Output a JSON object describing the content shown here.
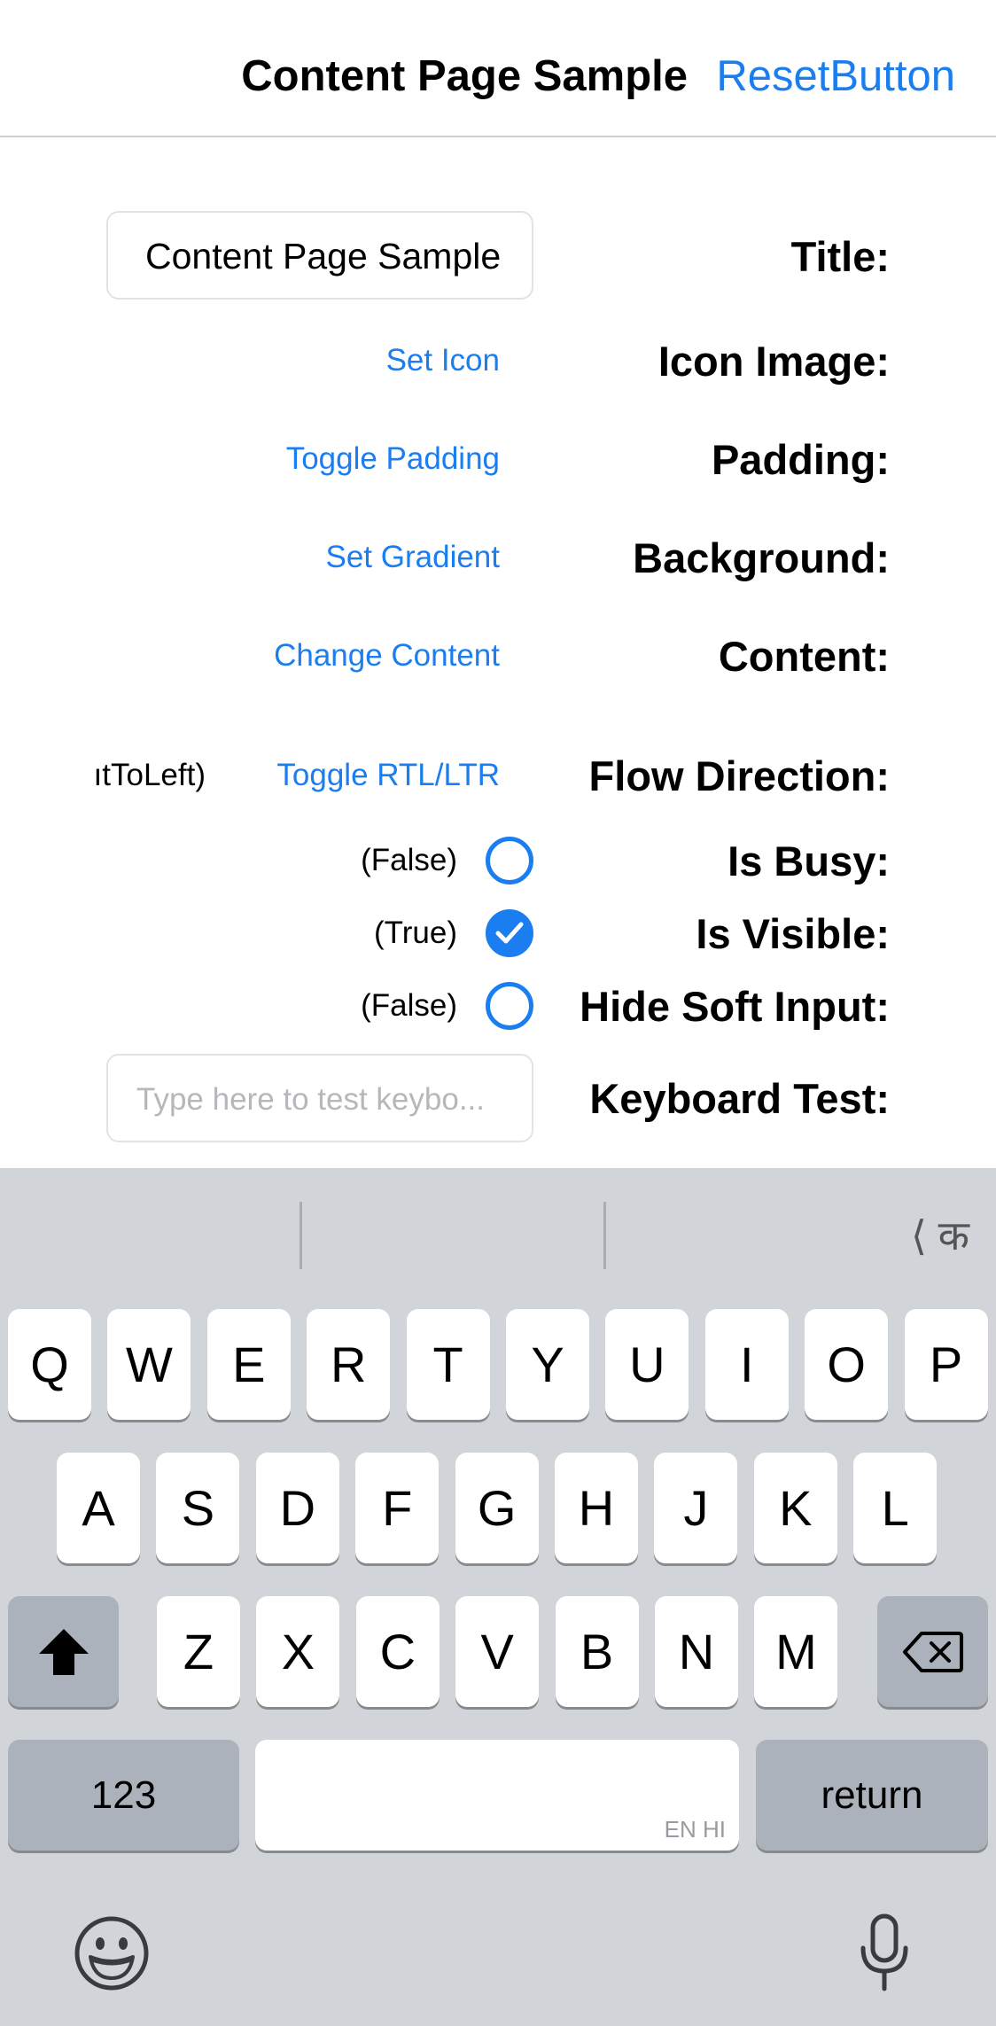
{
  "nav": {
    "title": "Content Page Sample",
    "reset_label": "ResetButton"
  },
  "form": {
    "title_label": "Title:",
    "title_value": "Content Page Sample",
    "icon_label": "Icon Image:",
    "icon_action": "Set Icon",
    "padding_label": "Padding:",
    "padding_action": "Toggle Padding",
    "background_label": "Background:",
    "background_action": "Set Gradient",
    "content_label": "Content:",
    "content_action": "Change Content",
    "flow_label": "Flow Direction:",
    "flow_value": "ıtToLeft)",
    "flow_action": "Toggle RTL/LTR",
    "busy_label": "Is Busy:",
    "busy_value": "(False)",
    "busy_checked": false,
    "visible_label": "Is Visible:",
    "visible_value": "(True)",
    "visible_checked": true,
    "hide_label": "Hide Soft Input:",
    "hide_value": "(False)",
    "hide_checked": false,
    "keyboard_label": "Keyboard Test:",
    "keyboard_placeholder": "Type here to test keybo..."
  },
  "keyboard": {
    "lang_switch": "⟨ क",
    "row1": [
      "Q",
      "W",
      "E",
      "R",
      "T",
      "Y",
      "U",
      "I",
      "O",
      "P"
    ],
    "row2": [
      "A",
      "S",
      "D",
      "F",
      "G",
      "H",
      "J",
      "K",
      "L"
    ],
    "row3": [
      "Z",
      "X",
      "C",
      "V",
      "B",
      "N",
      "M"
    ],
    "numbers_label": "123",
    "return_label": "return",
    "space_hint": "EN HI"
  },
  "colors": {
    "accent": "#1a7ef0",
    "keyboard_bg": "#d1d4d9",
    "dark_key": "#acb2bc"
  }
}
